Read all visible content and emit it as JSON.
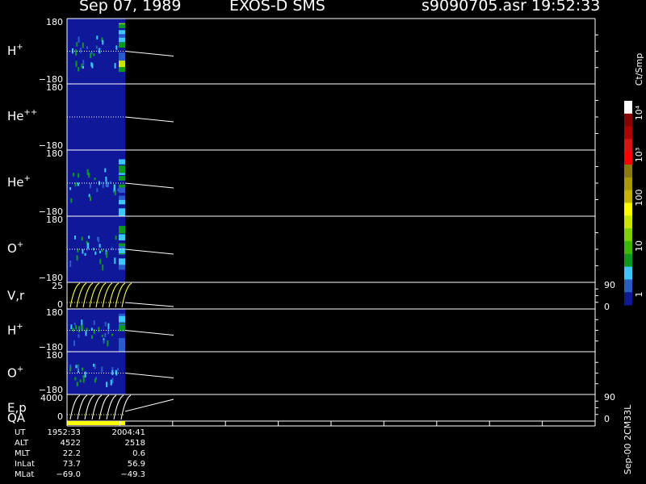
{
  "header": {
    "date": "Sep 07, 1989",
    "instrument": "EXOS-D SMS",
    "file": "s9090705.asr",
    "time": "19:52:33"
  },
  "colorbar": {
    "unit_label": "Ct/Smp",
    "tick_labels": [
      "10⁴",
      "10³",
      "100",
      "10",
      "1"
    ],
    "colors": [
      "#ffffff",
      "#8b0000",
      "#b00000",
      "#d81414",
      "#ff0000",
      "#8a7a10",
      "#a89a00",
      "#c8b400",
      "#ffff00",
      "#c8e600",
      "#7fd000",
      "#3cb800",
      "#0a9a20",
      "#3cc8ff",
      "#2a5cc8",
      "#10189a"
    ]
  },
  "vertical_label": "Sep-00 2CM33L",
  "chart_data": {
    "type": "heatmap",
    "colormap_low": "#10189a",
    "panels": [
      {
        "label": "H",
        "sup": "+",
        "ytop": "180",
        "ybot": "−180",
        "ylim": [
          -180,
          180
        ],
        "kind": "angle"
      },
      {
        "label": "He",
        "sup": "++",
        "ytop": "180",
        "ybot": "−180",
        "ylim": [
          -180,
          180
        ],
        "kind": "angle"
      },
      {
        "label": "He",
        "sup": "+",
        "ytop": "180",
        "ybot": "−180",
        "ylim": [
          -180,
          180
        ],
        "kind": "angle"
      },
      {
        "label": "O",
        "sup": "+",
        "ytop": "180",
        "ybot": "−180",
        "ylim": [
          -180,
          180
        ],
        "kind": "angle"
      },
      {
        "label": "V,r",
        "sup": "",
        "ytop": "25",
        "ybot": "0",
        "ylim": [
          0,
          25
        ],
        "kind": "line",
        "right_ticks": [
          "90",
          "0"
        ]
      },
      {
        "label": "H",
        "sup": "+",
        "ytop": "180",
        "ybot": "−180",
        "ylim": [
          -180,
          180
        ],
        "kind": "angle"
      },
      {
        "label": "O",
        "sup": "+",
        "ytop": "180",
        "ybot": "−180",
        "ylim": [
          -180,
          180
        ],
        "kind": "angle"
      },
      {
        "label": "E,p",
        "sup": "",
        "ytop": "4000",
        "ybot": "0",
        "ylim": [
          0,
          4000
        ],
        "kind": "line",
        "right_ticks": [
          "90",
          "0"
        ]
      }
    ],
    "qa_label": "QA"
  },
  "footer": {
    "rows": [
      {
        "label": "UT",
        "a": "1952:33",
        "b": "2004:41"
      },
      {
        "label": "ALT",
        "a": "4522",
        "b": "2518"
      },
      {
        "label": "MLT",
        "a": "22.2",
        "b": "0.6"
      },
      {
        "label": "InLat",
        "a": "73.7",
        "b": "56.9"
      },
      {
        "label": "MLat",
        "a": "−69.0",
        "b": "−49.3"
      }
    ]
  }
}
